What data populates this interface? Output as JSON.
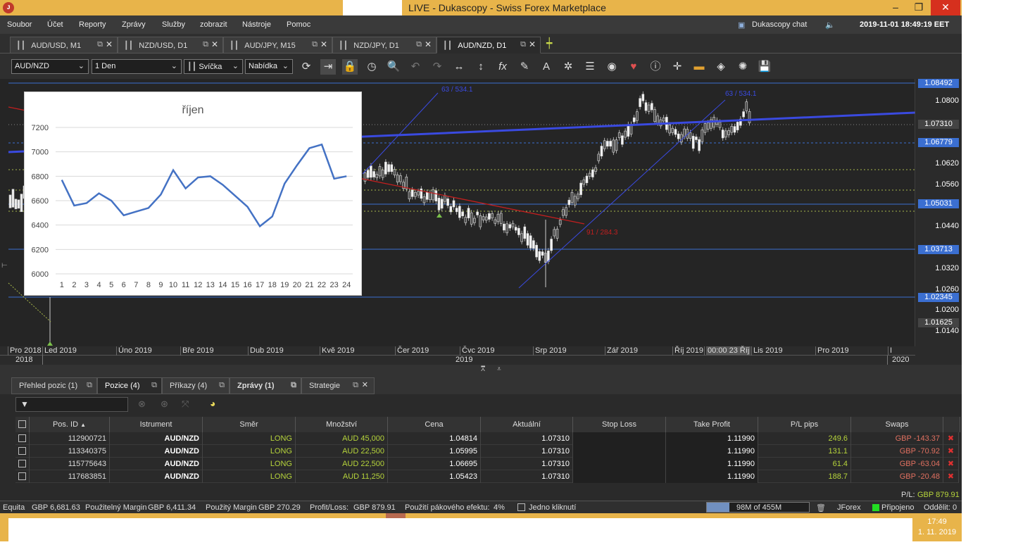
{
  "window": {
    "title": "LIVE - Dukascopy - Swiss Forex Marketplace",
    "controls": [
      "–",
      "❐",
      "✕"
    ]
  },
  "menu": {
    "items": [
      "Soubor",
      "Účet",
      "Reporty",
      "Zprávy",
      "Služby",
      "zobrazit",
      "Nástroje",
      "Pomoc"
    ],
    "chat": "Dukascopy chat",
    "datetime": "2019-11-01 18:49:19 EET"
  },
  "chart_tabs": [
    {
      "label": "AUD/USD, M1"
    },
    {
      "label": "NZD/USD, D1"
    },
    {
      "label": "AUD/JPY, M15"
    },
    {
      "label": "NZD/JPY, D1"
    },
    {
      "label": "AUD/NZD, D1",
      "active": true
    }
  ],
  "toolbar": {
    "instrument": "AUD/NZD",
    "period": "1 Den",
    "chart_type": "Svíčka",
    "side": "Nabídka"
  },
  "chart": {
    "y_ticks": [
      "1.0800",
      "1.0620",
      "1.0560",
      "1.0440",
      "1.0320",
      "1.0260",
      "1.0200",
      "1.0140"
    ],
    "price_markers": [
      {
        "value": "1.08492",
        "style": "blue"
      },
      {
        "value": "1.07310",
        "style": "dark"
      },
      {
        "value": "1.06779",
        "style": "blue"
      },
      {
        "value": "1.05031",
        "style": "blue"
      },
      {
        "value": "1.03713",
        "style": "blue"
      },
      {
        "value": "1.02345",
        "style": "blue"
      },
      {
        "value": "1.01625",
        "style": "dark"
      }
    ],
    "annotations": {
      "fib_top_left": "63 / 534.1",
      "fib_top_right": "63 / 534.1",
      "red_line": "91 / 284.3"
    },
    "x_months": [
      "Pro 2018",
      "Led 2019",
      "Úno 2019",
      "Bře 2019",
      "Dub 2019",
      "Kvě 2019",
      "Čer 2019",
      "Čvc 2019",
      "Srp 2019",
      "Zář 2019",
      "Říj 2019",
      "00:00 23 Říj",
      "Lis 2019",
      "Pro 2019",
      "I"
    ],
    "x_years": [
      "2018",
      "2019",
      "2020"
    ]
  },
  "chart_data": {
    "type": "line",
    "title": "říjen",
    "categories": [
      "1",
      "2",
      "3",
      "4",
      "5",
      "6",
      "7",
      "8",
      "9",
      "10",
      "11",
      "12",
      "13",
      "14",
      "15",
      "16",
      "17",
      "18",
      "19",
      "20",
      "21",
      "22",
      "23",
      "24"
    ],
    "series": [
      {
        "values": [
          6770,
          6560,
          6580,
          6660,
          6600,
          6480,
          6510,
          6540,
          6650,
          6850,
          6700,
          6790,
          6800,
          6730,
          6640,
          6550,
          6390,
          6470,
          6740,
          6890,
          7030,
          7060,
          6780,
          6800
        ]
      }
    ],
    "y_ticks": [
      "6000",
      "6200",
      "6400",
      "6600",
      "6800",
      "7000",
      "7200"
    ],
    "ylim": [
      6000,
      7200
    ],
    "grid": true,
    "color": "#4472c4"
  },
  "panel_tabs": [
    {
      "label": "Přehled pozic (1)"
    },
    {
      "label": "Pozice (4)",
      "active": true
    },
    {
      "label": "Příkazy (4)"
    },
    {
      "label": "Zprávy (1)"
    },
    {
      "label": "Strategie"
    }
  ],
  "table": {
    "headers": [
      "Pos. ID",
      "Istrument",
      "Směr",
      "Množství",
      "Cena",
      "Aktuální",
      "Stop Loss",
      "Take Profit",
      "P/L pips",
      "Swaps"
    ],
    "rows": [
      {
        "id": "112900721",
        "instrument": "AUD/NZD",
        "dir": "LONG",
        "qty": "AUD 45,000",
        "price": "1.04814",
        "current": "1.07310",
        "sl": "",
        "tp": "1.11990",
        "pips": "249.6",
        "swaps": "GBP -143.37"
      },
      {
        "id": "113340375",
        "instrument": "AUD/NZD",
        "dir": "LONG",
        "qty": "AUD 22,500",
        "price": "1.05995",
        "current": "1.07310",
        "sl": "",
        "tp": "1.11990",
        "pips": "131.1",
        "swaps": "GBP -70.92"
      },
      {
        "id": "115775643",
        "instrument": "AUD/NZD",
        "dir": "LONG",
        "qty": "AUD 22,500",
        "price": "1.06695",
        "current": "1.07310",
        "sl": "",
        "tp": "1.11990",
        "pips": "61.4",
        "swaps": "GBP -63.04"
      },
      {
        "id": "117683851",
        "instrument": "AUD/NZD",
        "dir": "LONG",
        "qty": "AUD 11,250",
        "price": "1.05423",
        "current": "1.07310",
        "sl": "",
        "tp": "1.11990",
        "pips": "188.7",
        "swaps": "GBP -20.48"
      }
    ],
    "pl_label": "P/L:",
    "pl_value": "GBP 879.91"
  },
  "status": {
    "equity_label": "Equita",
    "equity": "GBP 6,681.63",
    "umargin_label": "Použitelný Margin",
    "umargin": "GBP 6,411.34",
    "margin_label": "Použitý Margin",
    "margin": "GBP 270.29",
    "pl_label": "Profit/Loss:",
    "pl": "GBP 879.91",
    "lev_label": "Použití pákového efektu:",
    "lev": "4%",
    "oneclick": "Jedno kliknutí",
    "memory": "98M of 455M",
    "jforex": "JForex",
    "connected": "Připojeno",
    "detached": "Oddělit: 0"
  },
  "taskbar": {
    "time": "17:49",
    "date": "1. 11. 2019"
  }
}
